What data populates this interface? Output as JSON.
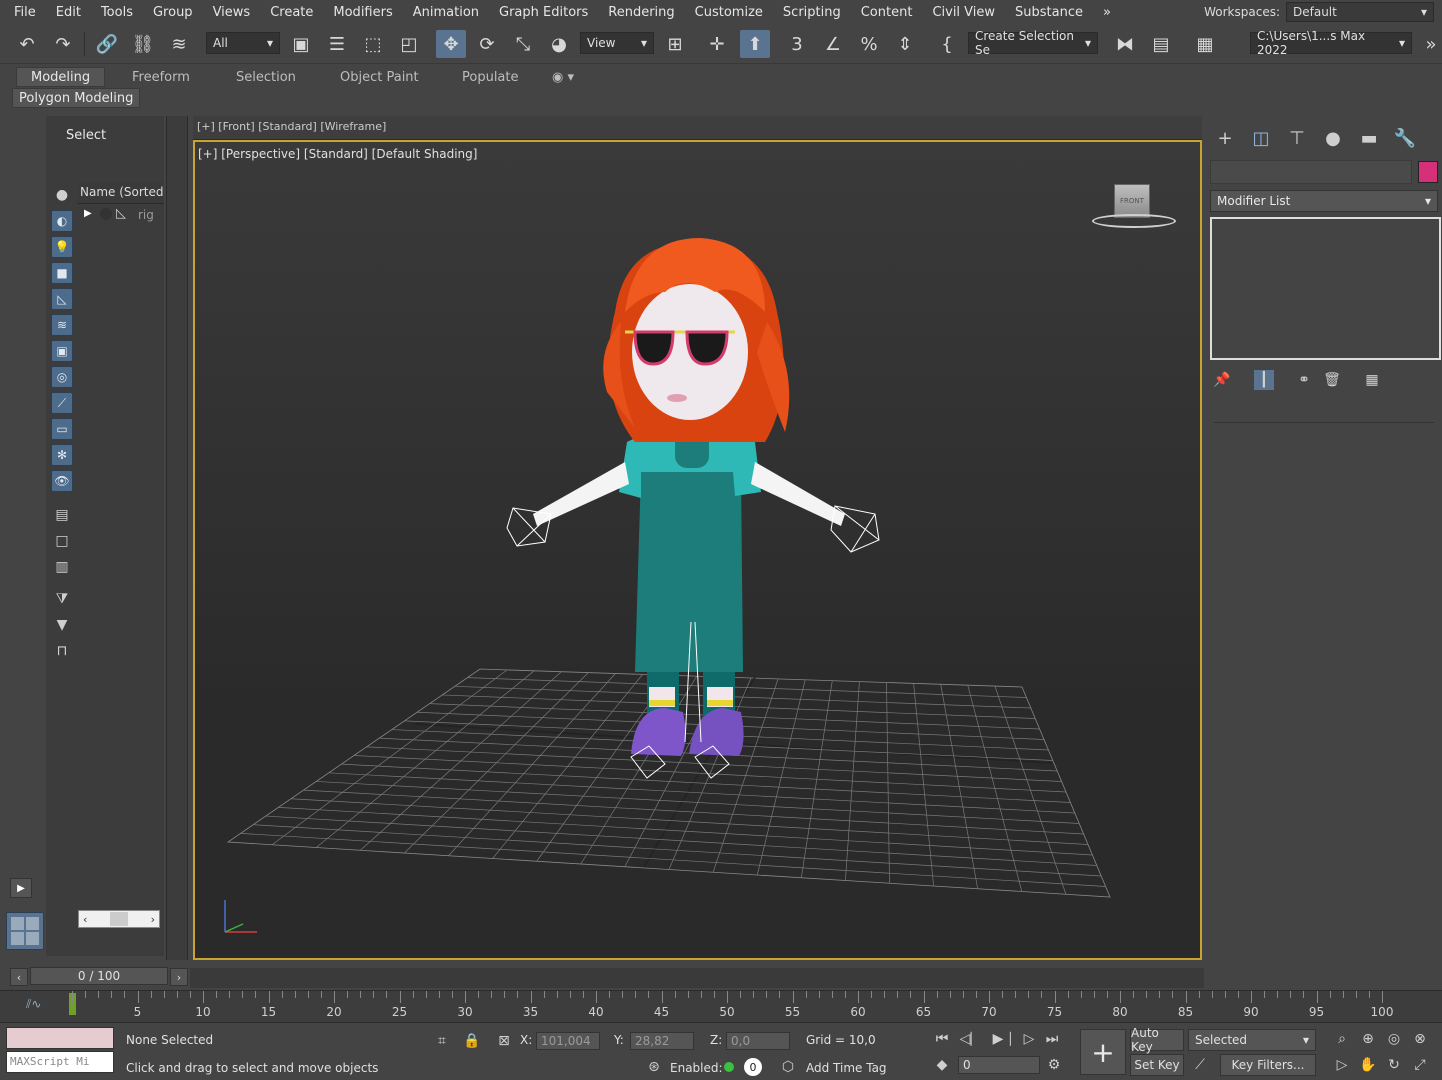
{
  "menu": [
    "File",
    "Edit",
    "Tools",
    "Group",
    "Views",
    "Create",
    "Modifiers",
    "Animation",
    "Graph Editors",
    "Rendering",
    "Customize",
    "Scripting",
    "Content",
    "Civil View",
    "Substance"
  ],
  "workspaces": {
    "label": "Workspaces:",
    "value": "Default"
  },
  "toolbar": {
    "filter_value": "All",
    "refcoord_value": "View",
    "selset_value": "Create Selection Se",
    "project_path": "C:\\Users\\1...s Max 2022"
  },
  "ribbon": {
    "tabs": [
      "Modeling",
      "Freeform",
      "Selection",
      "Object Paint",
      "Populate"
    ],
    "subtab": "Polygon Modeling"
  },
  "scene_explorer": {
    "header": "Select",
    "column": "Name (Sorted A",
    "item": "rig"
  },
  "viewport": {
    "top_label": "[+] [Front] [Standard] [Wireframe]",
    "label": "[+] [Perspective] [Standard] [Default Shading]",
    "viewcube_label": "FRONT"
  },
  "command_panel": {
    "modifier_list": "Modifier List",
    "object_color": "#d6307a"
  },
  "timeline": {
    "frame": "0 / 100",
    "ticks": [
      "5",
      "10",
      "15",
      "20",
      "25",
      "30",
      "35",
      "40",
      "45",
      "50",
      "55",
      "60",
      "65",
      "70",
      "75",
      "80",
      "85",
      "90",
      "95",
      "100"
    ]
  },
  "status": {
    "listener_placeholder": "MAXScript Mi",
    "selection": "None Selected",
    "prompt": "Click and drag to select and move objects",
    "x_label": "X:",
    "x_value": "101,004",
    "y_label": "Y:",
    "y_value": "28,82",
    "z_label": "Z:",
    "z_value": "0,0",
    "grid": "Grid = 10,0",
    "enabled": "Enabled:",
    "enabled_count": "0",
    "add_time_tag": "Add Time Tag",
    "frame_value": "0",
    "auto_key": "Auto Key",
    "set_key": "Set Key",
    "key_mode": "Selected",
    "key_filters": "Key Filters..."
  },
  "colors": {
    "accent": "#5a7391",
    "viewport_border": "#c8a52e",
    "hair": "#e8501a",
    "overalls": "#1c7d7a",
    "shirt": "#2fb9b6",
    "shoes": "#7f56c9"
  }
}
